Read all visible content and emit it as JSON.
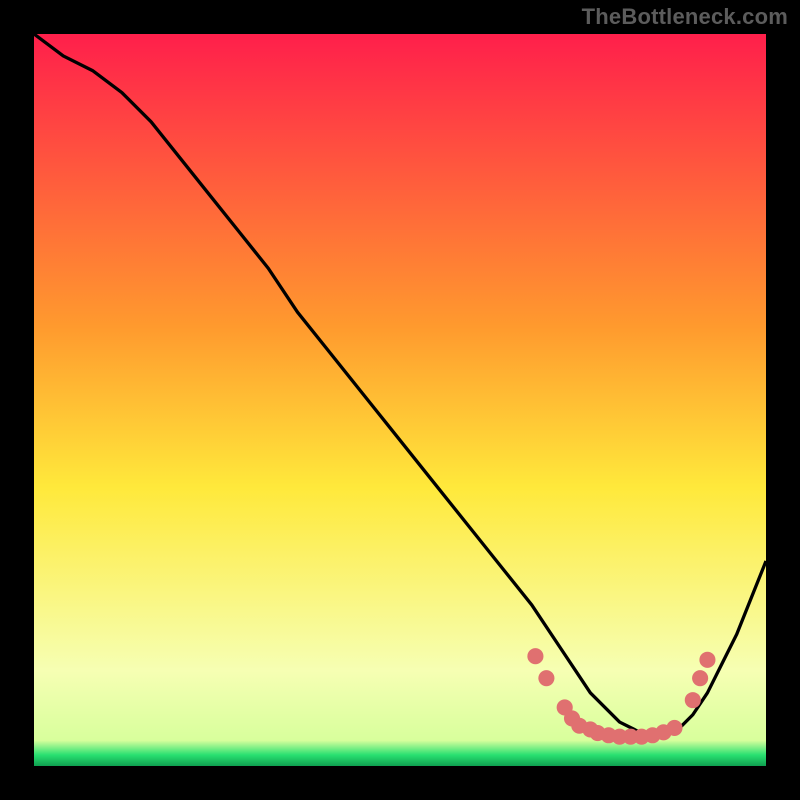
{
  "attribution": "TheBottleneck.com",
  "colors": {
    "gradient_top": "#ff1f4b",
    "gradient_mid1": "#ff9a2e",
    "gradient_mid2": "#ffe93b",
    "gradient_low": "#f6ffb3",
    "gradient_green": "#28e070",
    "curve": "#000000",
    "dots": "#e07070"
  },
  "chart_data": {
    "type": "line",
    "title": "",
    "xlabel": "",
    "ylabel": "",
    "xlim": [
      0,
      100
    ],
    "ylim": [
      0,
      100
    ],
    "grid": false,
    "series": [
      {
        "name": "curve",
        "x": [
          0,
          4,
          8,
          12,
          16,
          20,
          24,
          28,
          32,
          36,
          40,
          44,
          48,
          52,
          56,
          60,
          64,
          68,
          72,
          74,
          76,
          78,
          80,
          82,
          84,
          86,
          88,
          90,
          92,
          94,
          96,
          98,
          100
        ],
        "y": [
          100,
          97,
          95,
          92,
          88,
          83,
          78,
          73,
          68,
          62,
          57,
          52,
          47,
          42,
          37,
          32,
          27,
          22,
          16,
          13,
          10,
          8,
          6,
          5,
          4,
          4,
          5,
          7,
          10,
          14,
          18,
          23,
          28
        ]
      }
    ],
    "dots": [
      {
        "x": 68.5,
        "y": 15.0
      },
      {
        "x": 70.0,
        "y": 12.0
      },
      {
        "x": 72.5,
        "y": 8.0
      },
      {
        "x": 73.5,
        "y": 6.5
      },
      {
        "x": 74.5,
        "y": 5.5
      },
      {
        "x": 76.0,
        "y": 5.0
      },
      {
        "x": 77.0,
        "y": 4.5
      },
      {
        "x": 78.5,
        "y": 4.2
      },
      {
        "x": 80.0,
        "y": 4.0
      },
      {
        "x": 81.5,
        "y": 4.0
      },
      {
        "x": 83.0,
        "y": 4.0
      },
      {
        "x": 84.5,
        "y": 4.2
      },
      {
        "x": 86.0,
        "y": 4.6
      },
      {
        "x": 87.5,
        "y": 5.2
      },
      {
        "x": 90.0,
        "y": 9.0
      },
      {
        "x": 91.0,
        "y": 12.0
      },
      {
        "x": 92.0,
        "y": 14.5
      }
    ],
    "dot_radius": 1.1
  }
}
